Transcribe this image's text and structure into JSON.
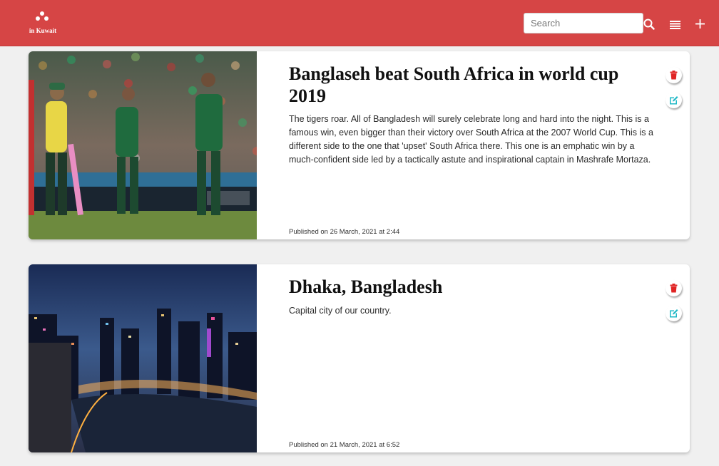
{
  "header": {
    "logo_text": "in Kuwait",
    "search_placeholder": "Search",
    "icons": [
      "search-icon",
      "list-icon",
      "plus-icon"
    ]
  },
  "colors": {
    "brand": "#d64545",
    "delete": "#e02424",
    "edit": "#1fb8c6",
    "background": "#f0f0f0"
  },
  "posts": [
    {
      "title": "Banglaseh beat South Africa in world cup 2019",
      "description": "The tigers roar. All of Bangladesh will surely celebrate long and hard into the night. This is a famous win, even bigger than their victory over South Africa at the 2007 World Cup. This is a different side to the one that 'upset' South Africa there. This one is an emphatic win by a much-confident side led by a tactically astute and inspirational captain in Mashrafe Mortaza.",
      "published": "Published on 26 March, 2021 at 2:44",
      "image": "cricket-match-photo",
      "actions": [
        "delete-icon",
        "edit-icon"
      ]
    },
    {
      "title": "Dhaka, Bangladesh",
      "description": "Capital city of our country.",
      "published": "Published on 21 March, 2021 at 6:52",
      "image": "dhaka-night-city-photo",
      "actions": [
        "delete-icon",
        "edit-icon"
      ]
    }
  ]
}
